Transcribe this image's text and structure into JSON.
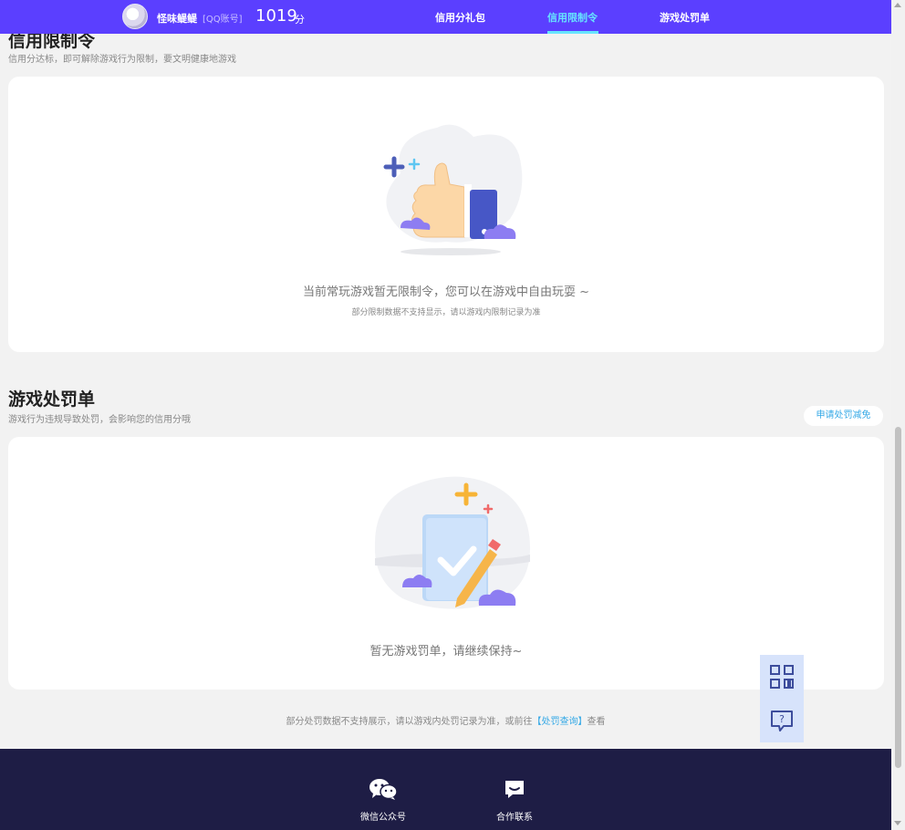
{
  "header": {
    "user_name": "怪味鳀鳀",
    "account_type": "[QQ账号]",
    "score": "1019",
    "score_unit": "分",
    "tabs": [
      {
        "label": "信用分礼包",
        "active": false
      },
      {
        "label": "信用限制令",
        "active": true
      },
      {
        "label": "游戏处罚单",
        "active": false
      }
    ],
    "accent_color": "#5b3fff",
    "active_tab_color": "#66e4ff"
  },
  "restriction": {
    "title": "信用限制令",
    "subtitle": "信用分达标，即可解除游戏行为限制，要文明健康地游戏",
    "empty_message": "当前常玩游戏暂无限制令，您可以在游戏中自由玩耍 ~",
    "note": "部分限制数据不支持显示，请以游戏内限制记录为准",
    "illustration_icon": "thumbs-up-icon"
  },
  "penalty": {
    "title": "游戏处罚单",
    "subtitle": "游戏行为违规导致处罚，会影响您的信用分哦",
    "appeal_button": "申请处罚减免",
    "empty_message": "暂无游戏罚单，请继续保持~",
    "illustration_icon": "checked-document-icon"
  },
  "footnote": {
    "prefix": "部分处罚数据不支持展示，请以游戏内处罚记录为准，或前往",
    "link": "【处罚查询】",
    "suffix": "查看"
  },
  "footer": {
    "items": [
      {
        "label": "微信公众号",
        "icon": "wechat-icon"
      },
      {
        "label": "合作联系",
        "icon": "chat-bubble-icon"
      }
    ],
    "background": "#1e1d45"
  },
  "floating": {
    "qr_icon": "qr-code-icon",
    "help_icon": "help-chat-icon"
  }
}
